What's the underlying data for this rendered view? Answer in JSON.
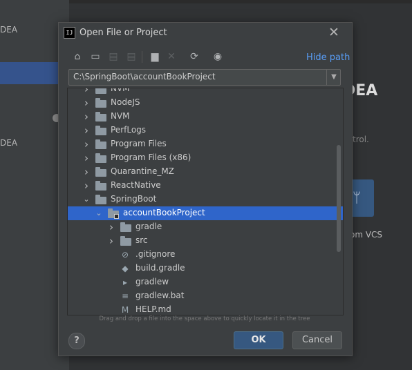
{
  "background": {
    "left_text_1": "DEA",
    "left_text_2": "DEA",
    "right_heading": "DEA",
    "right_subtext": "trol.",
    "right_vcs_text": "om VCS"
  },
  "dialog": {
    "title": "Open File or Project",
    "app_icon_text": "IJ",
    "close_glyph": "✕"
  },
  "toolbar": {
    "home": "⌂",
    "desktop": "▭",
    "project1": "▤",
    "project2": "▤",
    "new_folder": "▆",
    "delete": "✕",
    "refresh": "⟳",
    "show_hidden": "◉",
    "hide_path_label": "Hide path"
  },
  "path": {
    "value": "C:\\SpringBoot\\accountBookProject"
  },
  "tree": {
    "items": [
      {
        "label": "NVM",
        "kind": "folder",
        "indent": 0,
        "expanded": false,
        "partial": true
      },
      {
        "label": "NodeJS",
        "kind": "folder",
        "indent": 0,
        "expanded": false
      },
      {
        "label": "NVM",
        "kind": "folder",
        "indent": 0,
        "expanded": false
      },
      {
        "label": "PerfLogs",
        "kind": "folder",
        "indent": 0,
        "expanded": false
      },
      {
        "label": "Program Files",
        "kind": "folder",
        "indent": 0,
        "expanded": false
      },
      {
        "label": "Program Files (x86)",
        "kind": "folder",
        "indent": 0,
        "expanded": false
      },
      {
        "label": "Quarantine_MZ",
        "kind": "folder",
        "indent": 0,
        "expanded": false
      },
      {
        "label": "ReactNative",
        "kind": "folder",
        "indent": 0,
        "expanded": false
      },
      {
        "label": "SpringBoot",
        "kind": "folder",
        "indent": 0,
        "expanded": true
      },
      {
        "label": "accountBookProject",
        "kind": "project-folder",
        "indent": 1,
        "expanded": true,
        "selected": true
      },
      {
        "label": "gradle",
        "kind": "folder",
        "indent": 2,
        "expanded": false
      },
      {
        "label": "src",
        "kind": "folder",
        "indent": 2,
        "expanded": false
      },
      {
        "label": ".gitignore",
        "kind": "gitignore",
        "indent": 2
      },
      {
        "label": "build.gradle",
        "kind": "gradle",
        "indent": 2
      },
      {
        "label": "gradlew",
        "kind": "script",
        "indent": 2
      },
      {
        "label": "gradlew.bat",
        "kind": "text",
        "indent": 2
      },
      {
        "label": "HELP.md",
        "kind": "markdown",
        "indent": 2
      }
    ]
  },
  "hint": "Drag and drop a file into the space above to quickly locate it in the tree",
  "buttons": {
    "help": "?",
    "ok": "OK",
    "cancel": "Cancel"
  },
  "colors": {
    "selection": "#2f65ca",
    "link": "#589df6",
    "ok_button": "#365880"
  }
}
